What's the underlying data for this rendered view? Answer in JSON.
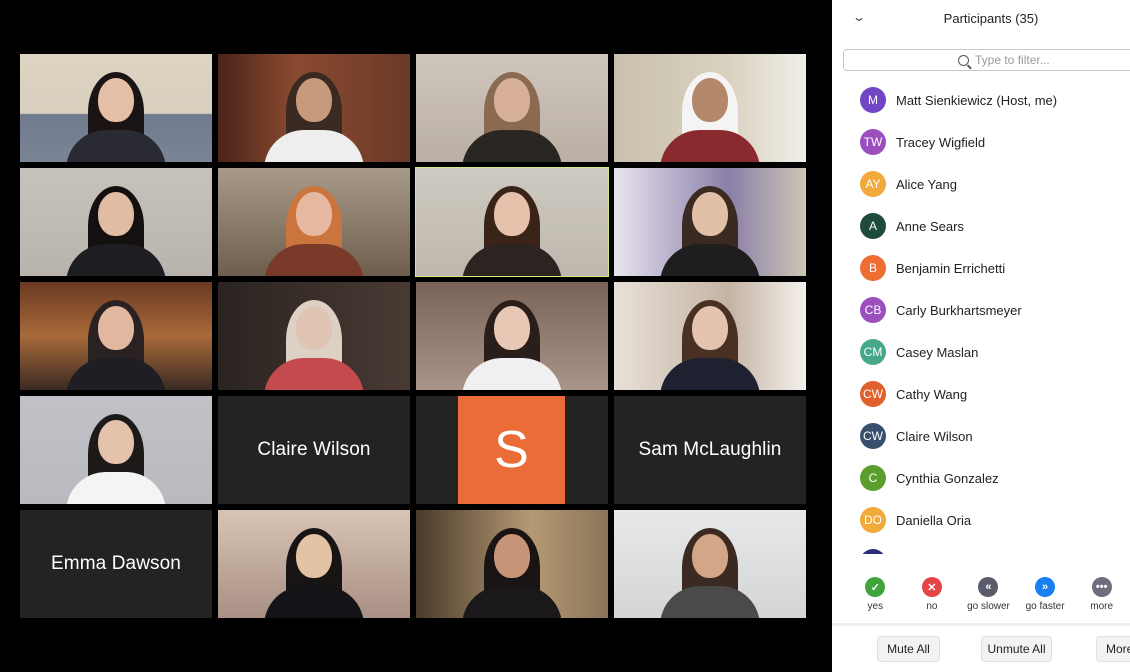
{
  "gallery": {
    "tiles": [
      {
        "type": "video",
        "label": "participant-video-1"
      },
      {
        "type": "video",
        "label": "participant-video-2"
      },
      {
        "type": "video",
        "label": "participant-video-3"
      },
      {
        "type": "video",
        "label": "participant-video-4"
      },
      {
        "type": "video",
        "label": "participant-video-5"
      },
      {
        "type": "video",
        "label": "participant-video-6"
      },
      {
        "type": "video",
        "label": "participant-video-7",
        "active_speaker": true
      },
      {
        "type": "video",
        "label": "participant-video-8"
      },
      {
        "type": "video",
        "label": "participant-video-9"
      },
      {
        "type": "video",
        "label": "participant-video-10"
      },
      {
        "type": "video",
        "label": "participant-video-11"
      },
      {
        "type": "video",
        "label": "participant-video-12"
      },
      {
        "type": "video",
        "label": "participant-video-13"
      },
      {
        "type": "name",
        "name": "Claire Wilson"
      },
      {
        "type": "avatar",
        "initial": "S",
        "color": "#ea6c36"
      },
      {
        "type": "name",
        "name": "Sam McLaughlin"
      },
      {
        "type": "name",
        "name": "Emma Dawson"
      },
      {
        "type": "video",
        "label": "participant-video-18"
      },
      {
        "type": "video",
        "label": "participant-video-19"
      },
      {
        "type": "video",
        "label": "participant-video-20"
      }
    ],
    "active_speaker_color": "#d8ea7a"
  },
  "panel": {
    "title": "Participants (35)",
    "collapse_icon": "chevron-down-icon",
    "filter_placeholder": "Type to filter...",
    "participants": [
      {
        "initials": "M",
        "name": "Matt Sienkiewicz (Host, me)",
        "color": "#7145c4"
      },
      {
        "initials": "TW",
        "name": "Tracey Wigfield",
        "color": "#9b4fbf"
      },
      {
        "initials": "AY",
        "name": "Alice Yang",
        "color": "#f2a93b"
      },
      {
        "initials": "A",
        "name": "Anne Sears",
        "color": "#1f4a3e"
      },
      {
        "initials": "B",
        "name": "Benjamin Errichetti",
        "color": "#ee6d33"
      },
      {
        "initials": "CB",
        "name": "Carly Burkhartsmeyer",
        "color": "#9b4fbf"
      },
      {
        "initials": "CM",
        "name": "Casey Maslan",
        "color": "#45a88a"
      },
      {
        "initials": "CW",
        "name": "Cathy Wang",
        "color": "#e0612b"
      },
      {
        "initials": "CW",
        "name": "Claire Wilson",
        "color": "#36506e"
      },
      {
        "initials": "C",
        "name": "Cynthia Gonzalez",
        "color": "#5c9e2e"
      },
      {
        "initials": "DO",
        "name": "Daniella Oria",
        "color": "#f2a93b"
      },
      {
        "initials": "",
        "name": "",
        "color": "#2e2a7c"
      }
    ],
    "reactions": [
      {
        "label": "yes",
        "icon": "check-icon",
        "glyph": "✓",
        "color": "#3ea43b"
      },
      {
        "label": "no",
        "icon": "x-icon",
        "glyph": "✕",
        "color": "#e54545"
      },
      {
        "label": "go slower",
        "icon": "rewind-icon",
        "glyph": "«",
        "color": "#5b5c6b"
      },
      {
        "label": "go faster",
        "icon": "fast-forward-icon",
        "glyph": "»",
        "color": "#1a7ff0"
      },
      {
        "label": "more",
        "icon": "more-icon",
        "glyph": "•••",
        "color": "#6d6e7d"
      }
    ],
    "footer": {
      "mute_all": "Mute All",
      "unmute_all": "Unmute All",
      "more": "More"
    }
  }
}
